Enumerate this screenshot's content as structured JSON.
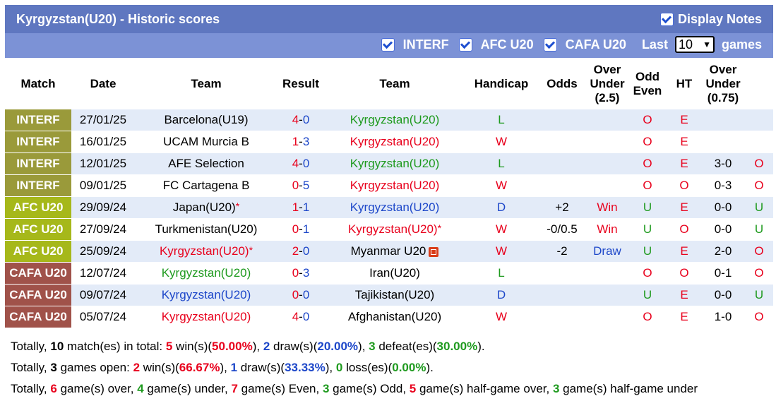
{
  "header": {
    "title": "Kyrgyzstan(U20) - Historic scores",
    "display_notes_label": "Display Notes"
  },
  "filters": {
    "options": [
      {
        "label": "INTERF",
        "checked": true
      },
      {
        "label": "AFC U20",
        "checked": true
      },
      {
        "label": "CAFA U20",
        "checked": true
      }
    ],
    "last_label": "Last",
    "last_value": "10",
    "games_label": "games"
  },
  "columns": {
    "match": "Match",
    "date": "Date",
    "team_home": "Team",
    "result": "Result",
    "team_away": "Team",
    "handicap": "Handicap",
    "odds": "Odds",
    "ou": [
      "Over",
      "Under",
      "(2.5)"
    ],
    "oe": [
      "Odd",
      "Even"
    ],
    "ht": "HT",
    "ou075": [
      "Over",
      "Under",
      "(0.75)"
    ]
  },
  "colors": {
    "INTERF": "#9a9a3a",
    "AFC U20": "#a6b81a",
    "CAFA U20": "#a0524a"
  },
  "rows": [
    {
      "comp": "INTERF",
      "date": "27/01/25",
      "home": "Barcelona(U19)",
      "home_color": "dark",
      "home_ast": false,
      "h": "4",
      "a": "0",
      "away": "Kyrgyzstan(U20)",
      "away_color": "green",
      "away_ast": false,
      "away_badge": false,
      "wl": "L",
      "handicap": "",
      "odds": "",
      "ou": "O",
      "oe": "E",
      "ht": "",
      "ou075": ""
    },
    {
      "comp": "INTERF",
      "date": "16/01/25",
      "home": "UCAM Murcia B",
      "home_color": "dark",
      "home_ast": false,
      "h": "1",
      "a": "3",
      "away": "Kyrgyzstan(U20)",
      "away_color": "red",
      "away_ast": false,
      "away_badge": false,
      "wl": "W",
      "handicap": "",
      "odds": "",
      "ou": "O",
      "oe": "E",
      "ht": "",
      "ou075": ""
    },
    {
      "comp": "INTERF",
      "date": "12/01/25",
      "home": "AFE Selection",
      "home_color": "dark",
      "home_ast": false,
      "h": "4",
      "a": "0",
      "away": "Kyrgyzstan(U20)",
      "away_color": "green",
      "away_ast": false,
      "away_badge": false,
      "wl": "L",
      "handicap": "",
      "odds": "",
      "ou": "O",
      "oe": "E",
      "ht": "3-0",
      "ou075": "O"
    },
    {
      "comp": "INTERF",
      "date": "09/01/25",
      "home": "FC Cartagena B",
      "home_color": "dark",
      "home_ast": false,
      "h": "0",
      "a": "5",
      "away": "Kyrgyzstan(U20)",
      "away_color": "red",
      "away_ast": false,
      "away_badge": false,
      "wl": "W",
      "handicap": "",
      "odds": "",
      "ou": "O",
      "oe": "O",
      "ht": "0-3",
      "ou075": "O"
    },
    {
      "comp": "AFC U20",
      "date": "29/09/24",
      "home": "Japan(U20)",
      "home_color": "dark",
      "home_ast": true,
      "h": "1",
      "a": "1",
      "away": "Kyrgyzstan(U20)",
      "away_color": "blue",
      "away_ast": false,
      "away_badge": false,
      "wl": "D",
      "handicap": "+2",
      "odds": "Win",
      "ou": "U",
      "oe": "E",
      "ht": "0-0",
      "ou075": "U"
    },
    {
      "comp": "AFC U20",
      "date": "27/09/24",
      "home": "Turkmenistan(U20)",
      "home_color": "dark",
      "home_ast": false,
      "h": "0",
      "a": "1",
      "away": "Kyrgyzstan(U20)",
      "away_color": "red",
      "away_ast": true,
      "away_badge": false,
      "wl": "W",
      "handicap": "-0/0.5",
      "odds": "Win",
      "ou": "U",
      "oe": "O",
      "ht": "0-0",
      "ou075": "U"
    },
    {
      "comp": "AFC U20",
      "date": "25/09/24",
      "home": "Kyrgyzstan(U20)",
      "home_color": "red",
      "home_ast": true,
      "h": "2",
      "a": "0",
      "away": "Myanmar U20",
      "away_color": "dark",
      "away_ast": false,
      "away_badge": true,
      "wl": "W",
      "handicap": "-2",
      "odds": "Draw",
      "ou": "U",
      "oe": "E",
      "ht": "2-0",
      "ou075": "O"
    },
    {
      "comp": "CAFA U20",
      "date": "12/07/24",
      "home": "Kyrgyzstan(U20)",
      "home_color": "green",
      "home_ast": false,
      "h": "0",
      "a": "3",
      "away": "Iran(U20)",
      "away_color": "dark",
      "away_ast": false,
      "away_badge": false,
      "wl": "L",
      "handicap": "",
      "odds": "",
      "ou": "O",
      "oe": "O",
      "ht": "0-1",
      "ou075": "O"
    },
    {
      "comp": "CAFA U20",
      "date": "09/07/24",
      "home": "Kyrgyzstan(U20)",
      "home_color": "blue",
      "home_ast": false,
      "h": "0",
      "a": "0",
      "away": "Tajikistan(U20)",
      "away_color": "dark",
      "away_ast": false,
      "away_badge": false,
      "wl": "D",
      "handicap": "",
      "odds": "",
      "ou": "U",
      "oe": "E",
      "ht": "0-0",
      "ou075": "U"
    },
    {
      "comp": "CAFA U20",
      "date": "05/07/24",
      "home": "Kyrgyzstan(U20)",
      "home_color": "red",
      "home_ast": false,
      "h": "4",
      "a": "0",
      "away": "Afghanistan(U20)",
      "away_color": "dark",
      "away_ast": false,
      "away_badge": false,
      "wl": "W",
      "handicap": "",
      "odds": "",
      "ou": "O",
      "oe": "E",
      "ht": "1-0",
      "ou075": "O"
    }
  ],
  "summary": {
    "line1": [
      {
        "t": "Totally, ",
        "c": "dark",
        "b": false
      },
      {
        "t": "10",
        "c": "dark",
        "b": true
      },
      {
        "t": " match(es) in total: ",
        "c": "dark",
        "b": false
      },
      {
        "t": "5",
        "c": "red",
        "b": true
      },
      {
        "t": " win(s)(",
        "c": "dark",
        "b": false
      },
      {
        "t": "50.00%",
        "c": "red",
        "b": true
      },
      {
        "t": "), ",
        "c": "dark",
        "b": false
      },
      {
        "t": "2",
        "c": "blue",
        "b": true
      },
      {
        "t": " draw(s)(",
        "c": "dark",
        "b": false
      },
      {
        "t": "20.00%",
        "c": "blue",
        "b": true
      },
      {
        "t": "), ",
        "c": "dark",
        "b": false
      },
      {
        "t": "3",
        "c": "green",
        "b": true
      },
      {
        "t": " defeat(es)(",
        "c": "dark",
        "b": false
      },
      {
        "t": "30.00%",
        "c": "green",
        "b": true
      },
      {
        "t": ").",
        "c": "dark",
        "b": false
      }
    ],
    "line2": [
      {
        "t": "Totally, ",
        "c": "dark",
        "b": false
      },
      {
        "t": "3",
        "c": "dark",
        "b": true
      },
      {
        "t": " games open: ",
        "c": "dark",
        "b": false
      },
      {
        "t": "2",
        "c": "red",
        "b": true
      },
      {
        "t": " win(s)(",
        "c": "dark",
        "b": false
      },
      {
        "t": "66.67%",
        "c": "red",
        "b": true
      },
      {
        "t": "), ",
        "c": "dark",
        "b": false
      },
      {
        "t": "1",
        "c": "blue",
        "b": true
      },
      {
        "t": " draw(s)(",
        "c": "dark",
        "b": false
      },
      {
        "t": "33.33%",
        "c": "blue",
        "b": true
      },
      {
        "t": "), ",
        "c": "dark",
        "b": false
      },
      {
        "t": "0",
        "c": "green",
        "b": true
      },
      {
        "t": " loss(es)(",
        "c": "dark",
        "b": false
      },
      {
        "t": "0.00%",
        "c": "green",
        "b": true
      },
      {
        "t": ").",
        "c": "dark",
        "b": false
      }
    ],
    "line3": [
      {
        "t": "Totally, ",
        "c": "dark",
        "b": false
      },
      {
        "t": "6",
        "c": "red",
        "b": true
      },
      {
        "t": " game(s) over, ",
        "c": "dark",
        "b": false
      },
      {
        "t": "4",
        "c": "green",
        "b": true
      },
      {
        "t": " game(s) under, ",
        "c": "dark",
        "b": false
      },
      {
        "t": "7",
        "c": "red",
        "b": true
      },
      {
        "t": " game(s) Even, ",
        "c": "dark",
        "b": false
      },
      {
        "t": "3",
        "c": "green",
        "b": true
      },
      {
        "t": " game(s) Odd, ",
        "c": "dark",
        "b": false
      },
      {
        "t": "5",
        "c": "red",
        "b": true
      },
      {
        "t": " game(s) half-game over, ",
        "c": "dark",
        "b": false
      },
      {
        "t": "3",
        "c": "green",
        "b": true
      },
      {
        "t": " game(s) half-game under",
        "c": "dark",
        "b": false
      }
    ]
  }
}
